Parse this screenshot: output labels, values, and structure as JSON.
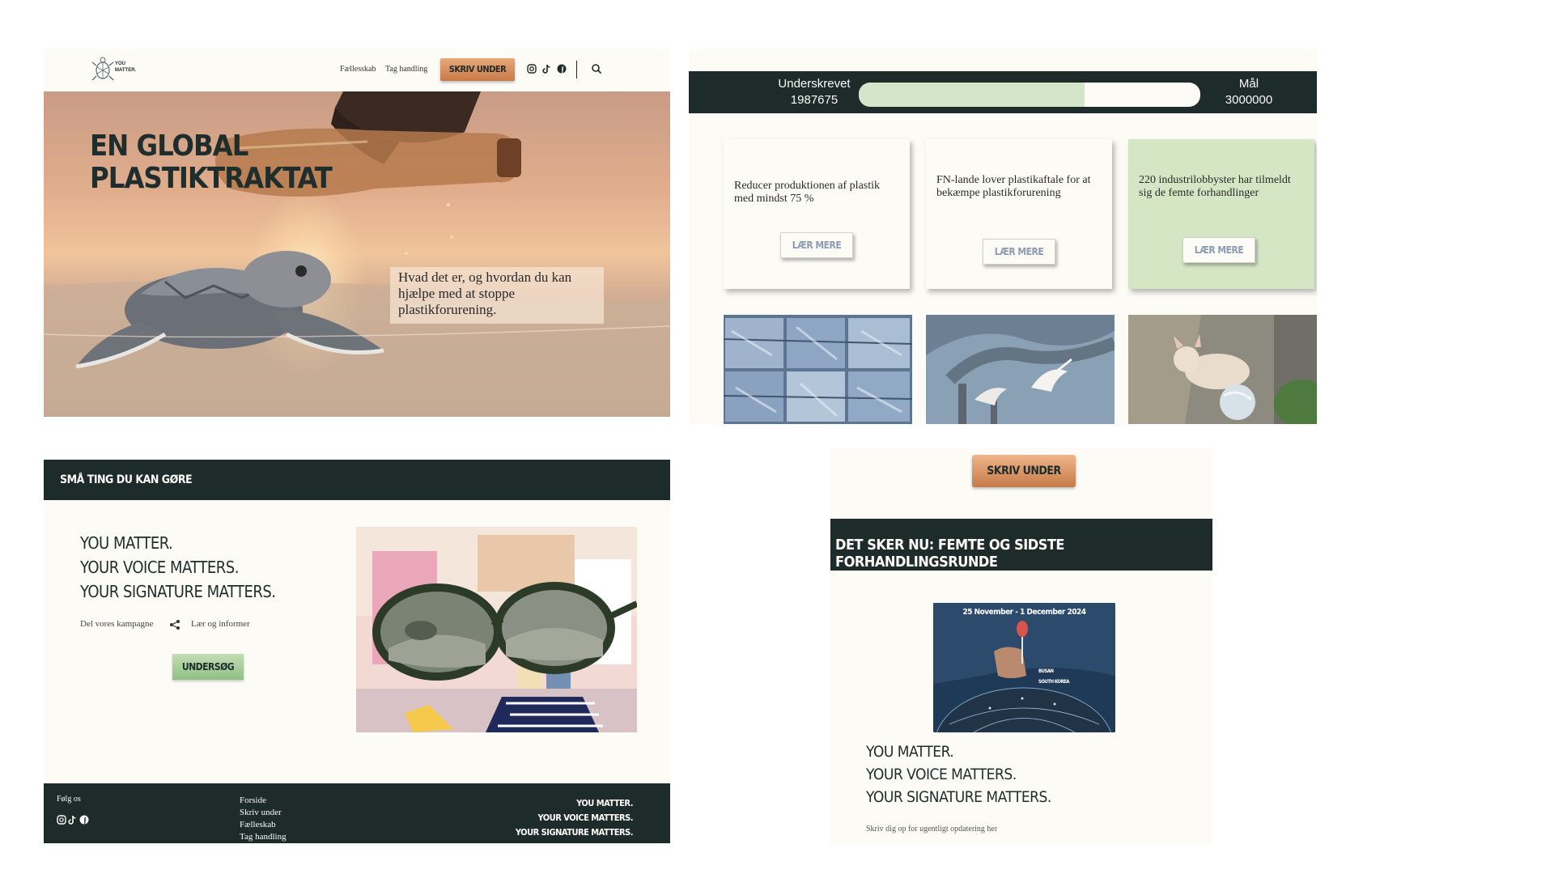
{
  "hero_page": {
    "logo": {
      "text_line1": "YOU",
      "text_line2": "MATTER."
    },
    "nav": {
      "links": [
        "Fællesskab",
        "Tag handling"
      ],
      "cta_label": "SKRIV UNDER",
      "icons": [
        "instagram-icon",
        "tiktok-icon",
        "facebook-icon",
        "search-icon"
      ]
    },
    "hero": {
      "title_line1": "EN GLOBAL",
      "title_line2": "PLASTIKTRAKTAT",
      "subtitle": "Hvad det er, og hvordan du kan hjælpe med at stoppe plastikforurening."
    }
  },
  "petition_page": {
    "progress": {
      "signed_label": "Underskrevet",
      "signed_value": "1987675",
      "goal_label": "Mål",
      "goal_value": "3000000",
      "fraction": 0.66
    },
    "cards": [
      {
        "text": "Reducer produktionen af plastik med mindst 75 %",
        "button": "LÆR MERE"
      },
      {
        "text": "FN-lande lover plastikaftale for at bekæmpe plastikforurening",
        "button": "LÆR MERE"
      },
      {
        "text": "220 industrilobbyster har tilmeldt sig de femte forhandlinger",
        "button": "LÆR MERE"
      }
    ]
  },
  "actions_page": {
    "header_title": "SMÅ TING DU KAN GØRE",
    "slogan": [
      "YOU MATTER.",
      "YOUR VOICE MATTERS.",
      "YOUR SIGNATURE MATTERS."
    ],
    "share_label": "Del vores kampagne",
    "learn_label": "Lær og informer",
    "button_label": "UNDERSØG",
    "footer": {
      "follow_label": "Følg os",
      "links": [
        "Forside",
        "Skriv under",
        "Fælleskab",
        "Tag handling"
      ],
      "slogan": [
        "YOU MATTER.",
        "YOUR VOICE MATTERS.",
        "YOUR SIGNATURE MATTERS."
      ]
    }
  },
  "news_page": {
    "cta_label": "SKRIV UNDER",
    "band_title": "DET SKER NU: FEMTE OG SIDSTE FORHANDLINGSRUNDE",
    "event": {
      "date": "25 November - 1 December 2024",
      "place_line1": "BUSAN",
      "place_line2": "SOUTH KOREA"
    },
    "slogan": [
      "YOU MATTER.",
      "YOUR VOICE MATTERS.",
      "YOUR SIGNATURE MATTERS."
    ],
    "signup_text": "Skriv dig op for ugentligt opdatering her"
  },
  "colors": {
    "dark": "#1e2b2b",
    "cream": "#fcfbf6",
    "accent_orange": "#d48a56",
    "accent_green": "#d4e6c4"
  }
}
